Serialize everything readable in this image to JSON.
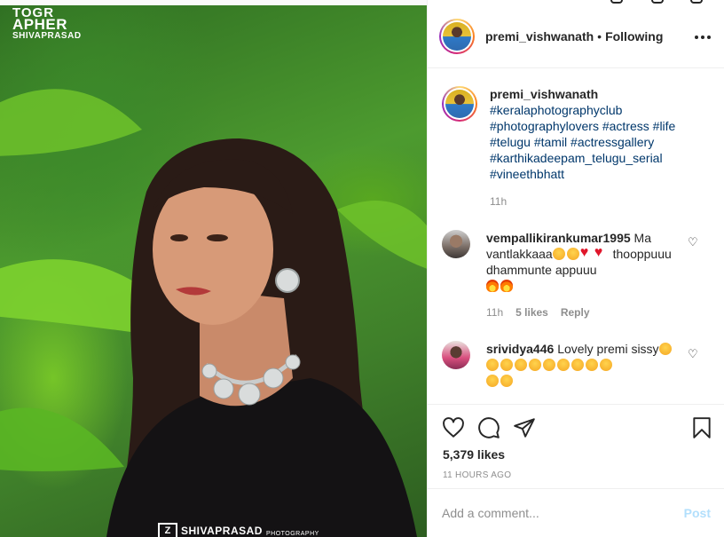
{
  "photo": {
    "watermark_top": [
      "TOGR",
      "APHER",
      "SHIVAPRASAD"
    ],
    "watermark_bottom": {
      "mark": "Z",
      "name": "SHIVAPRASAD",
      "sub": "PHOTOGRAPHY"
    }
  },
  "header": {
    "username": "premi_vishwanath",
    "separator": "•",
    "follow_state": "Following"
  },
  "caption": {
    "username": "premi_vishwanath",
    "hashtags": [
      "#keralaphotographyclub",
      "#photographylovers #actress #life",
      "#telugu #tamil #actressgallery",
      "#karthikadeepam_telugu_serial",
      "#vineethbhatt"
    ],
    "time": "11h"
  },
  "comments": [
    {
      "username": "vempallikirankumar1995",
      "text_a": "Ma vantlakkaaa",
      "text_b": "thooppuuu dhammunte appuuu",
      "time": "11h",
      "likes": "5 likes",
      "reply": "Reply"
    },
    {
      "username": "srividya446",
      "text_a": "Lovely premi sissy",
      "time": "",
      "likes": "",
      "reply": ""
    }
  ],
  "actions": {
    "likes": "5,379 likes",
    "ago": "11 HOURS AGO"
  },
  "add_comment": {
    "placeholder": "Add a comment...",
    "post_label": "Post"
  },
  "colors": {
    "link": "#00376b",
    "muted": "#8e8e8e",
    "post_disabled": "#b2dffc"
  },
  "icons": [
    "heart-icon",
    "comment-icon",
    "share-icon",
    "bookmark-icon",
    "more-icon",
    "like-comment-icon"
  ]
}
